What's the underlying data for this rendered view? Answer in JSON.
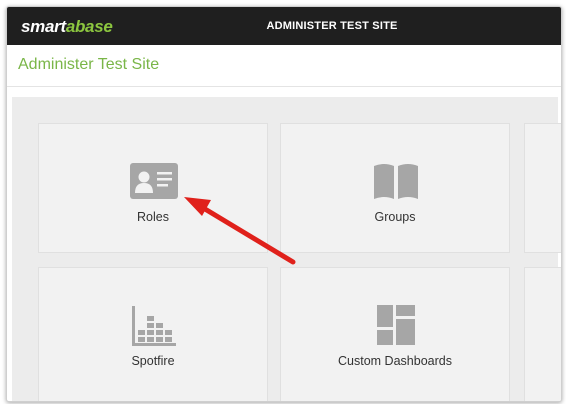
{
  "header": {
    "logo_part1": "smart",
    "logo_part2": "abase",
    "site_title": "ADMINISTER TEST SITE"
  },
  "page": {
    "heading": "Administer Test Site"
  },
  "tiles": [
    {
      "label": "Roles",
      "icon": "id-card-icon"
    },
    {
      "label": "Groups",
      "icon": "open-book-icon"
    },
    {
      "label": "Spotfire",
      "icon": "bar-chart-icon"
    },
    {
      "label": "Custom Dashboards",
      "icon": "dashboard-layout-icon"
    }
  ],
  "colors": {
    "topbar": "#1f1f1f",
    "brand_green": "#8cc63f",
    "heading_green": "#7ab648",
    "tile_bg": "#f2f2f2",
    "panel_bg": "#ececec",
    "icon_gray": "#a6a6a6",
    "annotation_arrow": "#e0211b"
  }
}
